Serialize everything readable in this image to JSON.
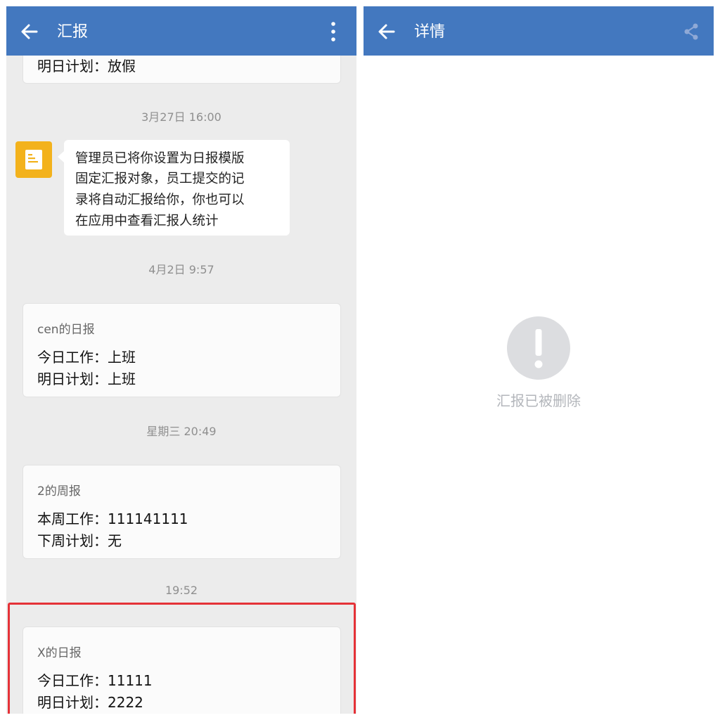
{
  "left": {
    "header": {
      "title": "汇报"
    },
    "top_partial": {
      "line": "明日计划：放假"
    },
    "timestamps": [
      "3月27日 16:00",
      "4月2日 9:57",
      "星期三 20:49",
      "19:52"
    ],
    "system_message": {
      "icon": "document-icon",
      "lines": [
        "管理员已将你设置为日报模版",
        "固定汇报对象，员工提交的记",
        "录将自动汇报给你，你也可以",
        "在应用中查看汇报人统计"
      ]
    },
    "reports": [
      {
        "title": "cen的日报",
        "lines": [
          "今日工作：上班",
          "明日计划：上班"
        ]
      },
      {
        "title": "2的周报",
        "lines": [
          "本周工作：111141111",
          "下周计划：无"
        ]
      },
      {
        "title": "X的日报",
        "lines": [
          "今日工作：11111",
          "明日计划：2222"
        ]
      }
    ]
  },
  "right": {
    "header": {
      "title": "详情"
    },
    "empty_state": {
      "icon": "exclamation-icon",
      "message": "汇报已被删除"
    }
  },
  "colors": {
    "header": "#4378bf",
    "highlight": "#e53238",
    "system_icon": "#f3b21c"
  }
}
